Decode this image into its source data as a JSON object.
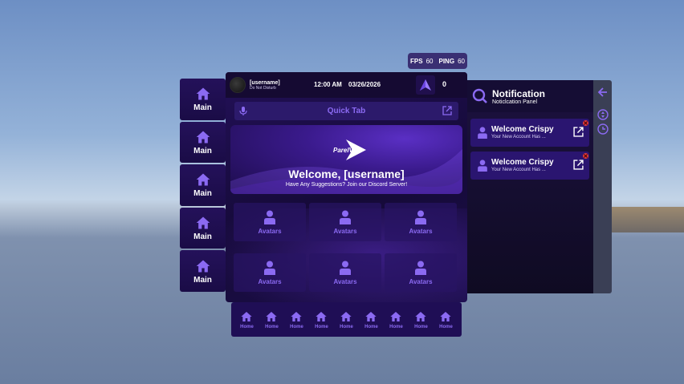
{
  "stats": {
    "fps_label": "FPS",
    "fps_value": "60",
    "ping_label": "PING",
    "ping_value": "60"
  },
  "sidebar": {
    "items": [
      {
        "label": "Main",
        "icon": "home-icon"
      },
      {
        "label": "Main",
        "icon": "home-icon"
      },
      {
        "label": "Main",
        "icon": "home-icon"
      },
      {
        "label": "Main",
        "icon": "home-icon"
      },
      {
        "label": "Main",
        "icon": "home-icon"
      }
    ]
  },
  "topbar": {
    "username": "[username]",
    "status": "Do Not Disturb",
    "time": "12:00 AM",
    "date": "03/26/2026",
    "count": "0"
  },
  "quick_tab": {
    "label": "Quick Tab"
  },
  "banner": {
    "brand": "ParelVR",
    "welcome": "Welcome, [username]",
    "subtitle": "Have Any Suggestions? Join our Discord Server!"
  },
  "tiles": [
    {
      "label": "Avatars"
    },
    {
      "label": "Avatars"
    },
    {
      "label": "Avatars"
    },
    {
      "label": "Avatars"
    },
    {
      "label": "Avatars"
    },
    {
      "label": "Avatars"
    }
  ],
  "dock": {
    "items": [
      {
        "label": "Home"
      },
      {
        "label": "Home"
      },
      {
        "label": "Home"
      },
      {
        "label": "Home"
      },
      {
        "label": "Home"
      },
      {
        "label": "Home"
      },
      {
        "label": "Home"
      },
      {
        "label": "Home"
      },
      {
        "label": "Home"
      }
    ]
  },
  "notification": {
    "title": "Notification",
    "subtitle": "Noticlcation Panel",
    "items": [
      {
        "title": "Welcome Crispy",
        "desc": "Your New Account Has ..."
      },
      {
        "title": "Welcome Crispy",
        "desc": "Your New Account Has ..."
      }
    ]
  },
  "colors": {
    "accent": "#8b6af2",
    "panel": "#1c0c4a",
    "close": "#e23a3a"
  }
}
